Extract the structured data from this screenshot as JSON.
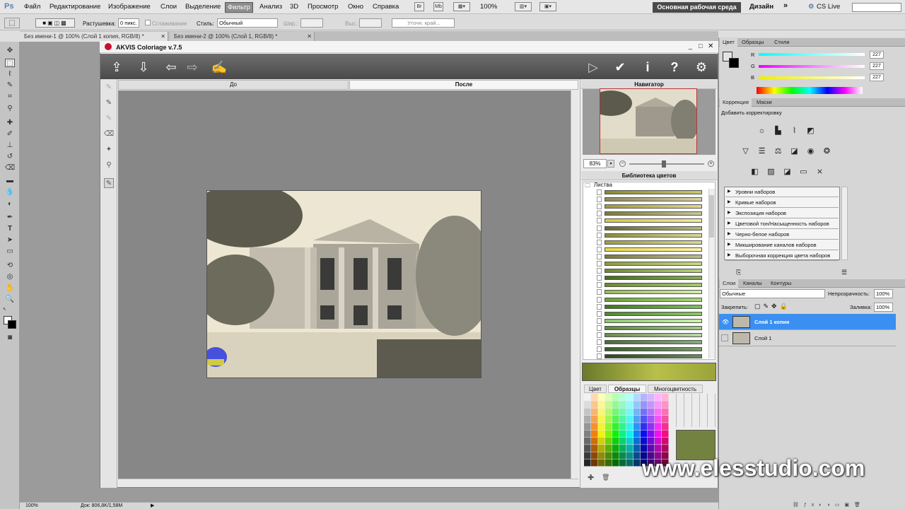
{
  "app": {
    "logo": "Ps"
  },
  "menu": [
    "Файл",
    "Редактирование",
    "Изображение",
    "Слои",
    "Выделение",
    "Фильтр",
    "Анализ",
    "3D",
    "Просмотр",
    "Окно",
    "Справка"
  ],
  "menu_active_index": 5,
  "menubar_extra": {
    "br": "Br",
    "mb": "Mb",
    "zoom": "100%",
    "workspace": "Основная рабочая среда",
    "design": "Дизайн",
    "more": "»",
    "cslive": "CS Live"
  },
  "options": {
    "feather_label": "Растушевка:",
    "feather_value": "0 пикс.",
    "antialias_label": "Сглаживание",
    "style_label": "Стиль:",
    "style_value": "Обычный",
    "width_label": "Шир.:",
    "height_label": "Выс.:",
    "refine_label": "Уточн. край..."
  },
  "doc_tabs": [
    "Без имени-1 @ 100% (Слой 1 копия, RGB/8) *",
    "Без имени-2 @ 100% (Слой 1, RGB/8) *"
  ],
  "akvis": {
    "title": "AKVIS Coloriage v.7.5",
    "before_tab": "До",
    "after_tab": "После",
    "navigator_title": "Навигатор",
    "zoom_value": "83%",
    "library_title": "Библиотека цветов",
    "library_folder": "Листва",
    "swatches": [
      [
        "#8a8a2a",
        "#c9c86a"
      ],
      [
        "#8a8a5a",
        "#d6d2a8"
      ],
      [
        "#a09a3a",
        "#e0d88a"
      ],
      [
        "#7a7a3a",
        "#c8c79a"
      ],
      [
        "#d8c83a",
        "#f2ea9a"
      ],
      [
        "#6a6a2a",
        "#b8b87a"
      ],
      [
        "#8c8a3a",
        "#dcd89a"
      ],
      [
        "#9aa03a",
        "#d8dc8a"
      ],
      [
        "#e6d84a",
        "#fff2aa"
      ],
      [
        "#7a7a3a",
        "#bcbc8a"
      ],
      [
        "#8a9a3a",
        "#c8d88a"
      ],
      [
        "#6a8a2a",
        "#b8d27a"
      ],
      [
        "#4a6a1a",
        "#8aaa5a"
      ],
      [
        "#6a8a2a",
        "#a8c86a"
      ],
      [
        "#9aba5a",
        "#d8ecaa"
      ],
      [
        "#6aa03a",
        "#aad87a"
      ],
      [
        "#3a7a1a",
        "#7ac05a"
      ],
      [
        "#4a8a2a",
        "#8ac86a"
      ],
      [
        "#8ac86a",
        "#caf0aa"
      ],
      [
        "#5a8a3a",
        "#a0c888"
      ],
      [
        "#6a8a4a",
        "#bcd8a8"
      ],
      [
        "#4a6a3a",
        "#8aac7a"
      ],
      [
        "#3a5a2a",
        "#7a9a6a"
      ],
      [
        "#2a4a1a",
        "#6a8a5a"
      ]
    ],
    "color_tabs": [
      "Цвет",
      "Образцы",
      "Многоцветность"
    ],
    "color_tab_active": 1,
    "sample_color": "#738240"
  },
  "ps_right": {
    "color_tabs": [
      "Цвет",
      "Образцы",
      "Стили"
    ],
    "rgb": [
      {
        "label": "R",
        "value": "227"
      },
      {
        "label": "G",
        "value": "227"
      },
      {
        "label": "B",
        "value": "227"
      }
    ],
    "adj_tabs": [
      "Коррекция",
      "Маски"
    ],
    "adj_title": "Добавить корректировку",
    "presets": [
      "Уровни наборов",
      "Кривые наборов",
      "Экспозиция наборов",
      "Цветовой тон/Насыщенность наборов",
      "Черно-белое наборов",
      "Микширование каналов наборов",
      "Выборочная коррекция цвета наборов"
    ],
    "layer_tabs": [
      "Слои",
      "Каналы",
      "Контуры"
    ],
    "blend_mode": "Обычные",
    "opacity_label": "Непрозрачность:",
    "opacity_value": "100%",
    "lock_label": "Закрепить:",
    "fill_label": "Заливка:",
    "fill_value": "100%",
    "layers": [
      "Слой 1 копия",
      "Слой 1"
    ]
  },
  "status": {
    "zoom": "100%",
    "doc": "Док: 806,8K/1,58M"
  },
  "watermark": "www.elesstudio.com"
}
